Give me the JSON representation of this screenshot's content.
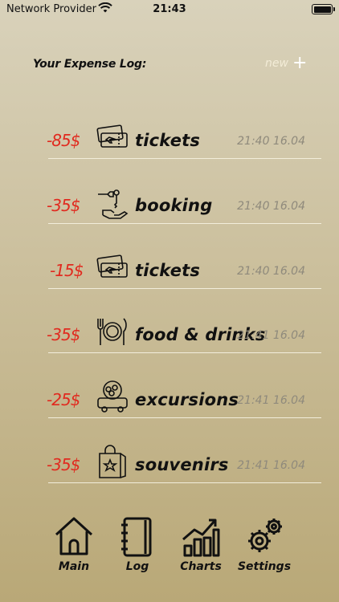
{
  "status_bar": {
    "carrier": "Network Provider",
    "time": "21:43"
  },
  "header": {
    "title": "Your Expense Log:",
    "new_label": "new",
    "plus": "+"
  },
  "expenses": [
    {
      "amount": "-85$",
      "category": "tickets",
      "icon": "tickets-icon",
      "time": "21:40 16.04"
    },
    {
      "amount": "-35$",
      "category": "booking",
      "icon": "booking-key-icon",
      "time": "21:40 16.04"
    },
    {
      "amount": "-15$",
      "category": "tickets",
      "icon": "tickets-icon",
      "time": "21:40 16.04"
    },
    {
      "amount": "-35$",
      "category": "food & drinks",
      "icon": "fork-plate-knife-icon",
      "time": "21:41 16.04"
    },
    {
      "amount": "-25$",
      "category": "excursions",
      "icon": "tour-bus-icon",
      "time": "21:41 16.04"
    },
    {
      "amount": "-35$",
      "category": "souvenirs",
      "icon": "souvenir-bag-icon",
      "time": "21:41 16.04"
    }
  ],
  "nav": [
    {
      "label": "Main",
      "icon": "home-icon"
    },
    {
      "label": "Log",
      "icon": "notebook-icon"
    },
    {
      "label": "Charts",
      "icon": "chart-icon"
    },
    {
      "label": "Settings",
      "icon": "gears-icon"
    }
  ],
  "colors": {
    "amount": "#e12a1f",
    "time": "#8f8a7c",
    "divider": "#f2eddb"
  }
}
